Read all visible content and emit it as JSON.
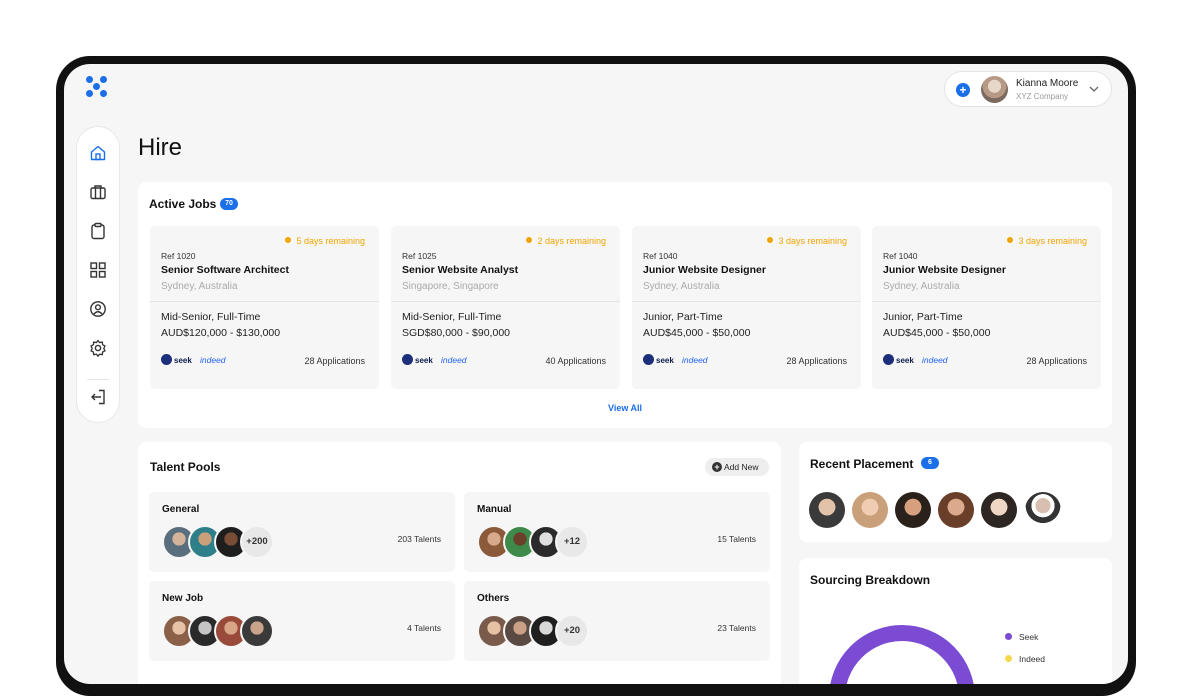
{
  "colors": {
    "accent": "#1b6fe8",
    "warning": "#f0a500",
    "seek": "#7b4cd3",
    "indeed": "#f5d84a"
  },
  "header": {
    "user_name": "Kianna Moore",
    "user_company": "XYZ Company"
  },
  "sidebar": {
    "items": [
      {
        "icon": "home-icon"
      },
      {
        "icon": "briefcase-icon"
      },
      {
        "icon": "clipboard-icon"
      },
      {
        "icon": "grid-icon"
      },
      {
        "icon": "user-pin-icon"
      },
      {
        "icon": "gear-icon"
      },
      {
        "icon": "logout-icon"
      }
    ]
  },
  "page": {
    "title": "Hire"
  },
  "active_jobs": {
    "title": "Active Jobs",
    "count": "70",
    "view_all": "View All",
    "jobs": [
      {
        "remaining": "5 days remaining",
        "ref": "Ref 1020",
        "title": "Senior Software Architect",
        "location": "Sydney, Australia",
        "type": "Mid-Senior, Full-Time",
        "salary": "AUD$120,000 - $130,000",
        "source1": "seek",
        "source2": "indeed",
        "applications": "28 Applications"
      },
      {
        "remaining": "2 days remaining",
        "ref": "Ref 1025",
        "title": "Senior Website Analyst",
        "location": "Singapore, Singapore",
        "type": "Mid-Senior, Full-Time",
        "salary": "SGD$80,000 - $90,000",
        "source1": "seek",
        "source2": "indeed",
        "applications": "40 Applications"
      },
      {
        "remaining": "3 days remaining",
        "ref": "Ref 1040",
        "title": "Junior Website Designer",
        "location": "Sydney, Australia",
        "type": "Junior, Part-Time",
        "salary": "AUD$45,000 - $50,000",
        "source1": "seek",
        "source2": "indeed",
        "applications": "28 Applications"
      },
      {
        "remaining": "3 days remaining",
        "ref": "Ref 1040",
        "title": "Junior Website Designer",
        "location": "Sydney, Australia",
        "type": "Junior, Part-Time",
        "salary": "AUD$45,000 - $50,000",
        "source1": "seek",
        "source2": "indeed",
        "applications": "28 Applications"
      }
    ]
  },
  "talent_pools": {
    "title": "Talent Pools",
    "add_new": "Add New",
    "pools": [
      {
        "name": "General",
        "more": "+200",
        "count": "203 Talents"
      },
      {
        "name": "Manual",
        "more": "+12",
        "count": "15 Talents"
      },
      {
        "name": "New Job",
        "more": "",
        "count": "4 Talents"
      },
      {
        "name": "Others",
        "more": "+20",
        "count": "23 Talents"
      }
    ]
  },
  "recent_placement": {
    "title": "Recent Placement",
    "count": "6"
  },
  "sourcing": {
    "title": "Sourcing Breakdown",
    "legend": [
      {
        "label": "Seek",
        "color": "#7b4cd3"
      },
      {
        "label": "Indeed",
        "color": "#f5d84a"
      }
    ]
  }
}
